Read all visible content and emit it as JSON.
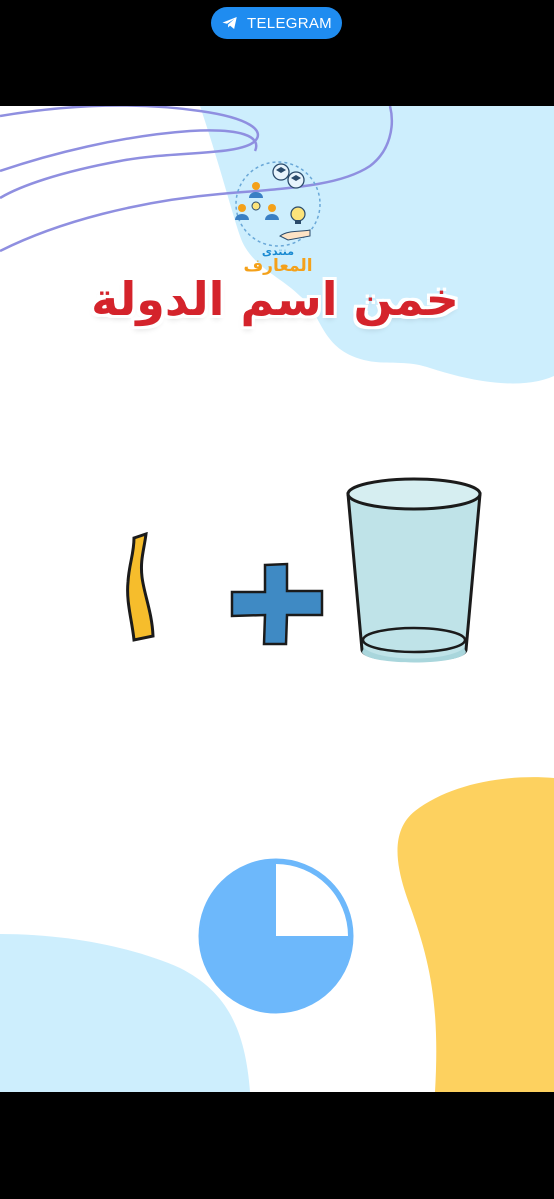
{
  "banner": {
    "label": "TELEGRAM",
    "icon": "telegram-icon"
  },
  "logo": {
    "line1": "منتدى",
    "line2": "المعارف",
    "icon": "community-ideas-icon"
  },
  "title": "خمن اسم الدولة",
  "puzzle": {
    "items": [
      "glass-icon",
      "plus-icon",
      "alif-letter-icon"
    ]
  },
  "timer": {
    "remaining_fraction": 0.75
  },
  "colors": {
    "banner_bg": "#1f8cf0",
    "title": "#d4232b",
    "blob_blue": "#cdeefd",
    "blob_yellow": "#fdd15f",
    "timer_blue": "#6db8fb",
    "plus_blue": "#3f8ac4",
    "alif_yellow": "#f6bd2c"
  }
}
